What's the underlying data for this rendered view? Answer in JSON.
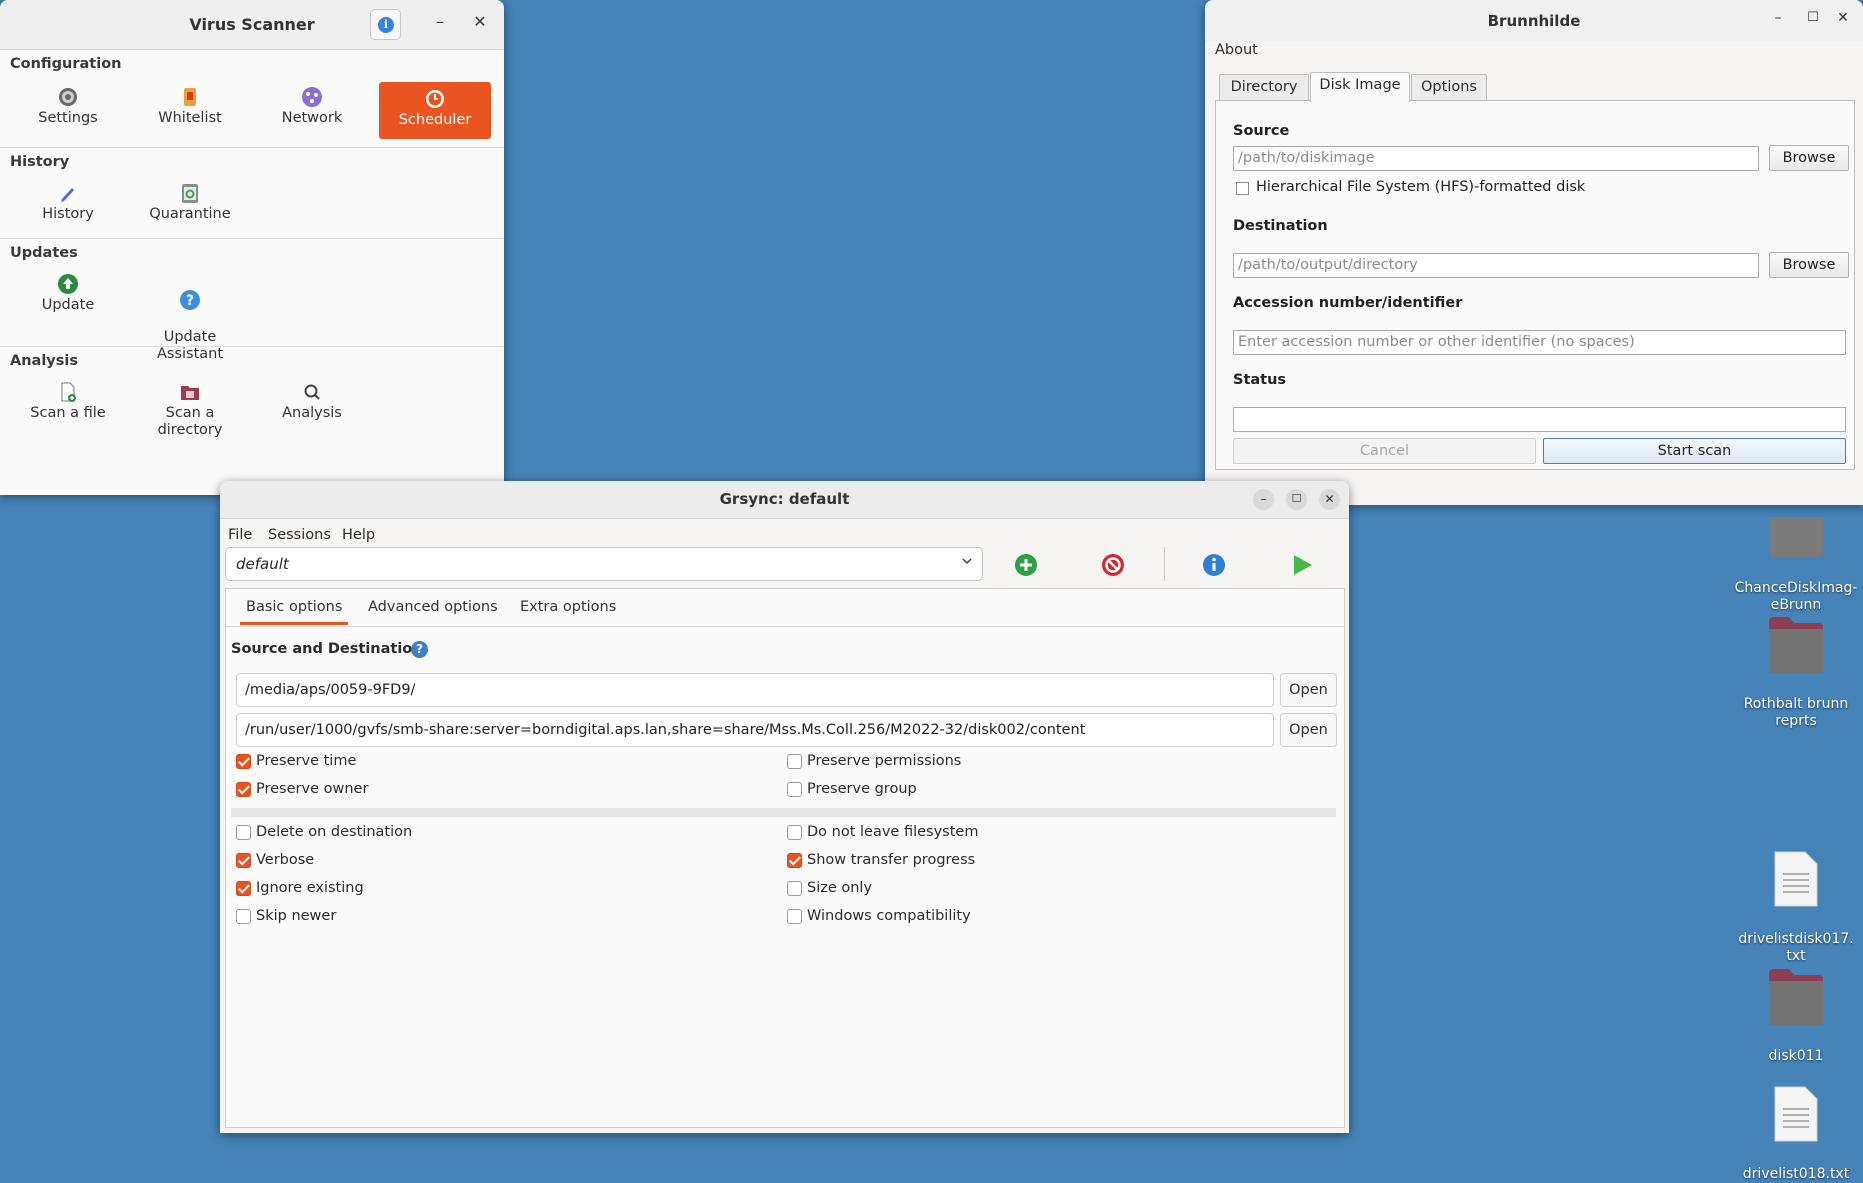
{
  "virus_scanner": {
    "title": "Virus Scanner",
    "sections": [
      {
        "heading": "Configuration",
        "items": [
          {
            "label": "Settings",
            "icon": "gear-icon"
          },
          {
            "label": "Whitelist",
            "icon": "whitelist-icon"
          },
          {
            "label": "Network",
            "icon": "network-icon"
          },
          {
            "label": "Scheduler",
            "icon": "clock-icon",
            "active": true
          }
        ]
      },
      {
        "heading": "History",
        "items": [
          {
            "label": "History",
            "icon": "pencil-icon"
          },
          {
            "label": "Quarantine",
            "icon": "recycle-icon"
          }
        ]
      },
      {
        "heading": "Updates",
        "items": [
          {
            "label": "Update",
            "icon": "upload-icon"
          },
          {
            "label": "Update\nAssistant",
            "icon": "question-icon"
          }
        ]
      },
      {
        "heading": "Analysis",
        "items": [
          {
            "label": "Scan a file",
            "icon": "file-add-icon"
          },
          {
            "label": "Scan a\ndirectory",
            "icon": "folder-scan-icon"
          },
          {
            "label": "Analysis",
            "icon": "magnifier-icon"
          }
        ]
      }
    ]
  },
  "brunnhilde": {
    "title": "Brunnhilde",
    "menu_about": "About",
    "tabs": [
      "Directory",
      "Disk Image",
      "Options"
    ],
    "selected_tab": "Disk Image",
    "source_label": "Source",
    "source_placeholder": "/path/to/diskimage",
    "browse_label": "Browse",
    "hfs_label": "Hierarchical File System (HFS)-formatted disk",
    "destination_label": "Destination",
    "destination_placeholder": "/path/to/output/directory",
    "accession_label": "Accession number/identifier",
    "accession_placeholder": "Enter accession number or other identifier (no spaces)",
    "status_label": "Status",
    "status_value": "",
    "cancel_label": "Cancel",
    "start_label": "Start scan"
  },
  "grsync": {
    "title": "Grsync: default",
    "menu": [
      "File",
      "Sessions",
      "Help"
    ],
    "session": "default",
    "tabs": [
      "Basic options",
      "Advanced options",
      "Extra options"
    ],
    "source_dest_label": "Source and Destination:",
    "source_path": "/media/aps/0059-9FD9/",
    "dest_path": "/run/user/1000/gvfs/smb-share:server=borndigital.aps.lan,share=share/Mss.Ms.Coll.256/M2022-32/disk002/content",
    "open_label": "Open",
    "options_top": [
      {
        "label": "Preserve time",
        "checked": true
      },
      {
        "label": "Preserve permissions",
        "checked": false
      },
      {
        "label": "Preserve owner",
        "checked": true
      },
      {
        "label": "Preserve group",
        "checked": false
      }
    ],
    "options_bottom": [
      {
        "label": "Delete on destination",
        "checked": false
      },
      {
        "label": "Do not leave filesystem",
        "checked": false
      },
      {
        "label": "Verbose",
        "checked": true
      },
      {
        "label": "Show transfer progress",
        "checked": true
      },
      {
        "label": "Ignore existing",
        "checked": true
      },
      {
        "label": "Size only",
        "checked": false
      },
      {
        "label": "Skip newer",
        "checked": false
      },
      {
        "label": "Windows compatibility",
        "checked": false
      }
    ]
  },
  "desktop": [
    {
      "label": "ChanceDiskImag-\neBrunn",
      "icon": "folder-icon"
    },
    {
      "label": "Rothbalt brunn\nreprts",
      "icon": "folder-icon"
    },
    {
      "label": "drivelistdisk017.\ntxt",
      "icon": "text-file-icon"
    },
    {
      "label": "disk011",
      "icon": "folder-icon"
    },
    {
      "label": "drivelist018.txt",
      "icon": "text-file-icon"
    }
  ],
  "colors": {
    "desktop_bg": "#4583b8",
    "accent": "#e95420",
    "folder": "#8c3e52"
  }
}
